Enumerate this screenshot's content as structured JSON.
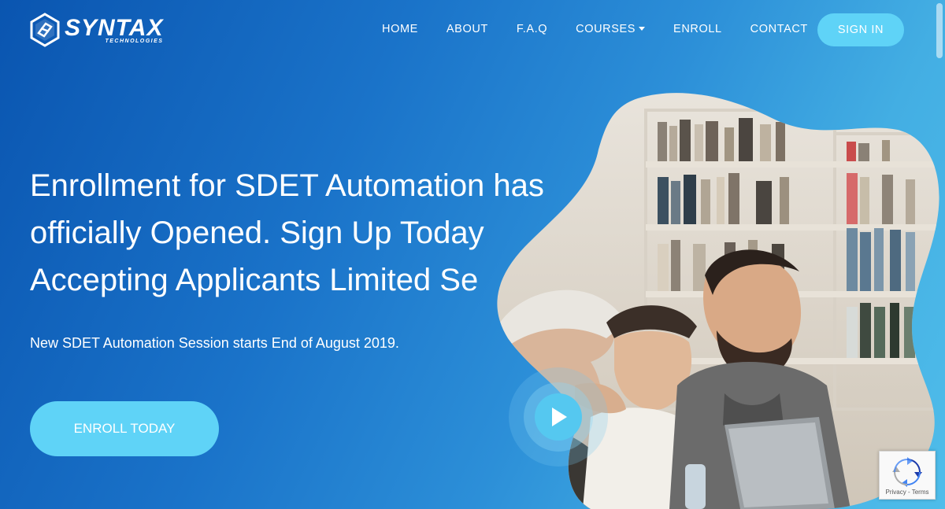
{
  "brand": {
    "name": "SYNTAX",
    "sub": "TECHNOLOGIES"
  },
  "nav": {
    "items": [
      {
        "label": "HOME"
      },
      {
        "label": "ABOUT"
      },
      {
        "label": "F.A.Q"
      },
      {
        "label": "COURSES"
      },
      {
        "label": "ENROLL"
      },
      {
        "label": "CONTACT"
      }
    ],
    "signin_label": "SIGN IN"
  },
  "hero": {
    "title_lines": [
      "Enrollment for SDET Automation has",
      "officially Opened. Sign Up Today",
      "Accepting Applicants Limited Se"
    ],
    "subtitle": "New SDET Automation Session starts End of August 2019.",
    "cta_label": "ENROLL TODAY"
  },
  "recaptcha": {
    "terms": "Privacy - Terms"
  },
  "colors": {
    "accent": "#5fd3f7",
    "gradient_start": "#0a55b0",
    "gradient_end": "#4fbdea"
  }
}
